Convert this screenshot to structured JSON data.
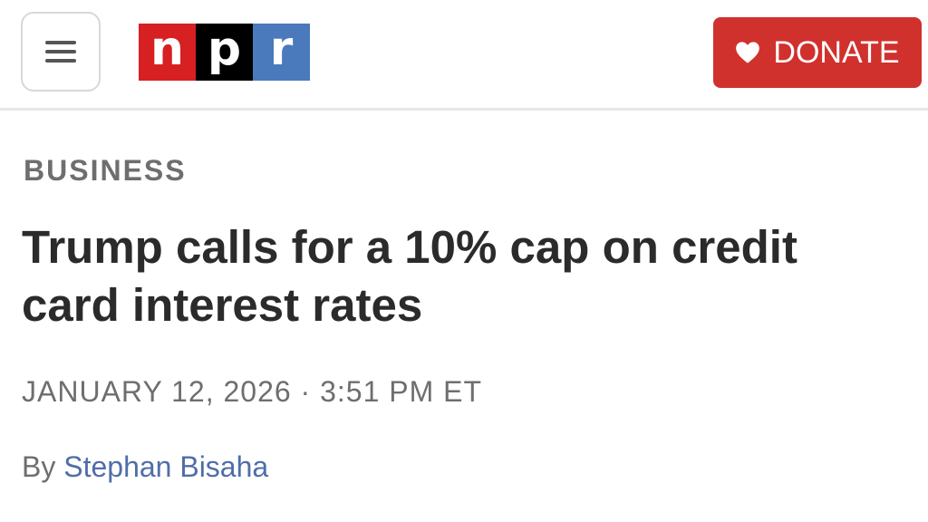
{
  "header": {
    "menu_icon": "hamburger-menu-icon",
    "logo": {
      "letters": [
        "n",
        "p",
        "r"
      ],
      "colors": [
        "#d62021",
        "#000000",
        "#4a7abb"
      ]
    },
    "donate": {
      "label": "DONATE",
      "icon": "heart-icon",
      "color": "#d0312d"
    }
  },
  "article": {
    "section": "BUSINESS",
    "headline": "Trump calls for a 10% cap on credit card interest rates",
    "dateline": "JANUARY 12, 2026 · 3:51 PM ET",
    "byline_prefix": "By",
    "author": "Stephan Bisaha",
    "author_color": "#4f6ea8"
  }
}
